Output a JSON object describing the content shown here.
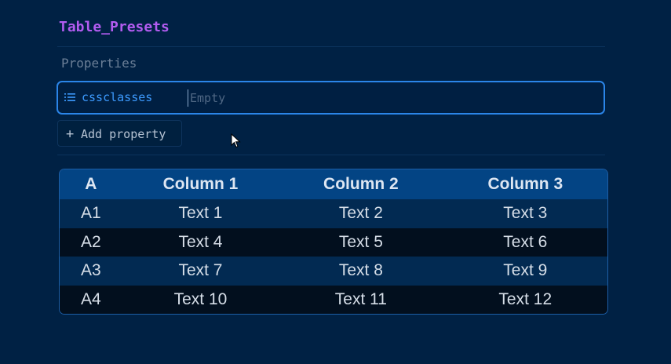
{
  "document": {
    "title": "Table_Presets"
  },
  "properties": {
    "heading": "Properties",
    "items": [
      {
        "icon": "list-icon",
        "key": "cssclasses",
        "value_placeholder": "Empty"
      }
    ],
    "add_label": "Add property",
    "add_icon": "plus-icon"
  },
  "table": {
    "headers": [
      "A",
      "Column 1",
      "Column 2",
      "Column 3"
    ],
    "rows": [
      [
        "A1",
        "Text 1",
        "Text 2",
        "Text 3"
      ],
      [
        "A2",
        "Text 4",
        "Text 5",
        "Text 6"
      ],
      [
        "A3",
        "Text 7",
        "Text 8",
        "Text 9"
      ],
      [
        "A4",
        "Text 10",
        "Text 11",
        "Text 12"
      ]
    ]
  },
  "colors": {
    "background": "#002144",
    "title": "#b25cf0",
    "accent": "#2b85e8",
    "table_header": "#034484"
  }
}
